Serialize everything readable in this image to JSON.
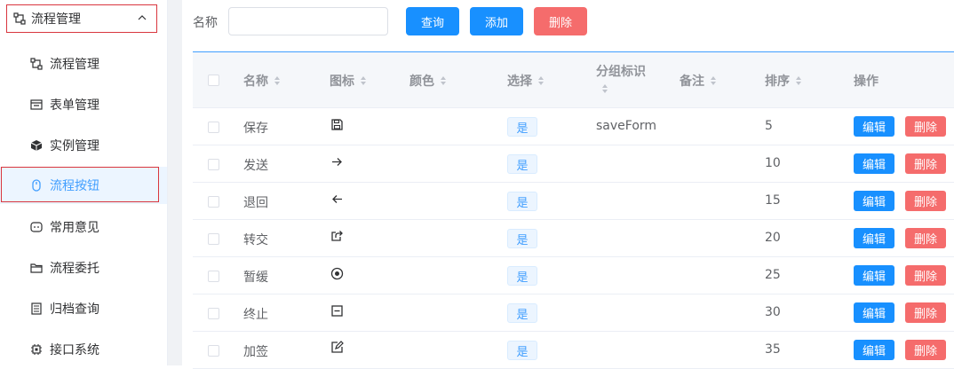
{
  "sidebar": {
    "header": {
      "label": "流程管理",
      "icon": "workflow-icon"
    },
    "items": [
      {
        "label": "流程管理",
        "icon": "workflow-icon",
        "active": false
      },
      {
        "label": "表单管理",
        "icon": "form-icon",
        "active": false
      },
      {
        "label": "实例管理",
        "icon": "cube-icon",
        "active": false
      },
      {
        "label": "流程按钮",
        "icon": "mouse-icon",
        "active": true
      },
      {
        "label": "常用意见",
        "icon": "comment-icon",
        "active": false
      },
      {
        "label": "流程委托",
        "icon": "folder-icon",
        "active": false
      },
      {
        "label": "归档查询",
        "icon": "archive-icon",
        "active": false
      },
      {
        "label": "接口系统",
        "icon": "chip-icon",
        "active": false
      }
    ]
  },
  "search": {
    "label": "名称",
    "value": "",
    "placeholder": ""
  },
  "toolbar": {
    "query_label": "查询",
    "add_label": "添加",
    "delete_label": "删除"
  },
  "table": {
    "columns": {
      "name": "名称",
      "icon": "图标",
      "color": "颜色",
      "select": "选择",
      "group_id": "分组标识",
      "remark": "备注",
      "order": "排序",
      "actions": "操作"
    },
    "edit_label": "编辑",
    "delete_label": "删除",
    "rows": [
      {
        "name": "保存",
        "icon": "save-icon",
        "select": "是",
        "group_id": "saveForm",
        "order": "5"
      },
      {
        "name": "发送",
        "icon": "arrow-right-icon",
        "select": "是",
        "group_id": "",
        "order": "10"
      },
      {
        "name": "退回",
        "icon": "arrow-left-icon",
        "select": "是",
        "group_id": "",
        "order": "15"
      },
      {
        "name": "转交",
        "icon": "share-icon",
        "select": "是",
        "group_id": "",
        "order": "20"
      },
      {
        "name": "暂缓",
        "icon": "record-icon",
        "select": "是",
        "group_id": "",
        "order": "25"
      },
      {
        "name": "终止",
        "icon": "minus-square-icon",
        "select": "是",
        "group_id": "",
        "order": "30"
      },
      {
        "name": "加签",
        "icon": "edit-square-icon",
        "select": "是",
        "group_id": "",
        "order": "35"
      }
    ]
  },
  "colors": {
    "primary": "#1890ff",
    "danger": "#f56c6c",
    "active_bg": "#ecf5ff",
    "highlight_border": "#d9363e"
  }
}
